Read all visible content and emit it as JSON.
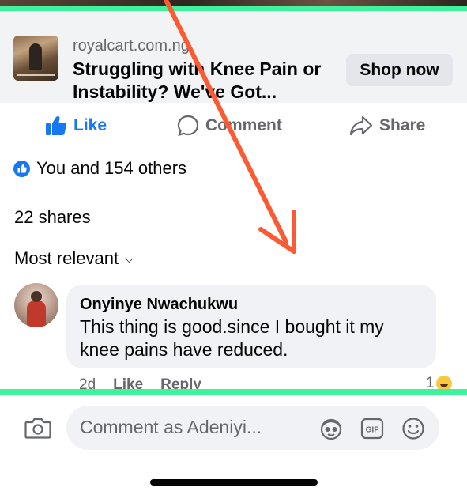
{
  "ad": {
    "domain": "royalcart.com.ng",
    "title": "Struggling with Knee Pain or Instability? We've Got...",
    "cta": "Shop now"
  },
  "actions": {
    "like": "Like",
    "comment": "Comment",
    "share": "Share"
  },
  "reactions": {
    "summary": "You and 154 others"
  },
  "shares": "22 shares",
  "sort": {
    "label": "Most relevant"
  },
  "comment": {
    "author": "Onyinye Nwachukwu",
    "text": "This thing is good.since I bought it my knee pains have reduced.",
    "time": "2d",
    "like": "Like",
    "reply": "Reply",
    "reaction_count": "1"
  },
  "composer": {
    "placeholder": "Comment as Adeniyi..."
  },
  "colors": {
    "accent": "#1877f2",
    "annotation_arrow": "#fc5a33",
    "highlight_line": "#3ff29c"
  }
}
